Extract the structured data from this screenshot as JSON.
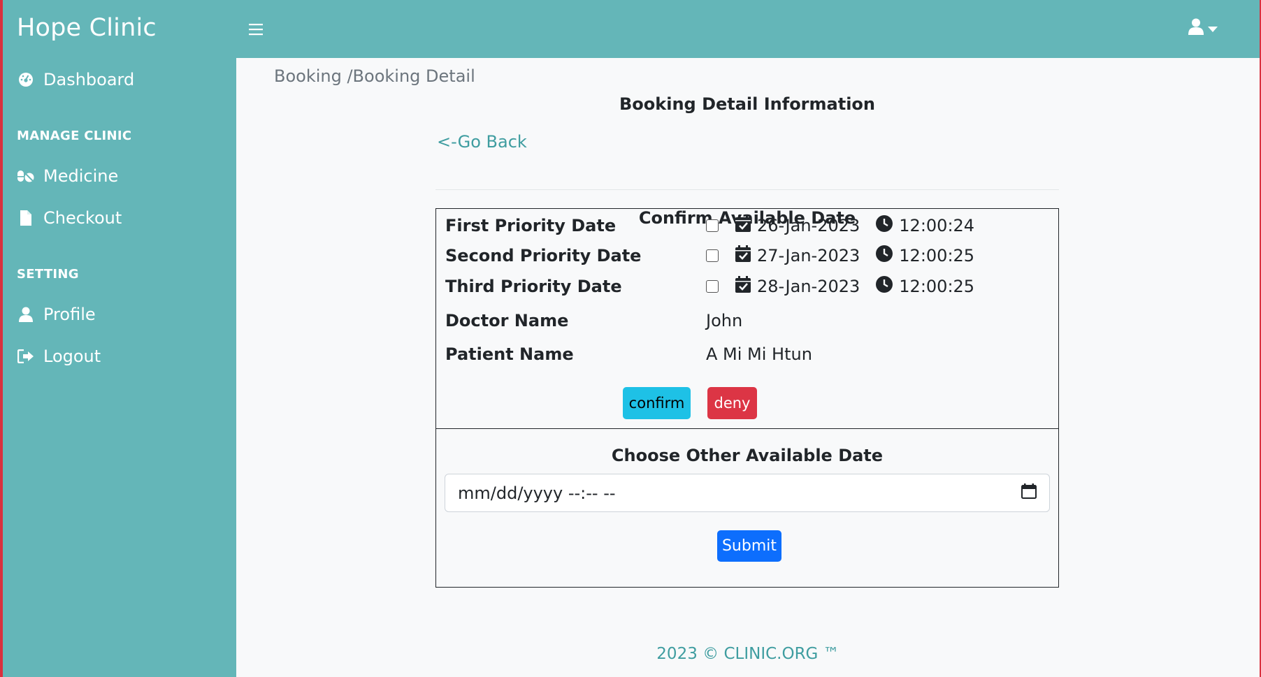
{
  "sidebar": {
    "brand": "Hope Clinic",
    "items": [
      {
        "label": "Dashboard",
        "icon": "dashboard-gauge-icon"
      },
      {
        "label": "Medicine",
        "icon": "pills-icon"
      },
      {
        "label": "Checkout",
        "icon": "file-icon"
      },
      {
        "label": "Profile",
        "icon": "user-icon"
      },
      {
        "label": "Logout",
        "icon": "logout-icon"
      }
    ],
    "headings": [
      "MANAGE CLINIC",
      "SETTING"
    ]
  },
  "topbar": {
    "menu_icon": "hamburger-icon",
    "user_icon": "user-icon",
    "caret_icon": "caret-down-icon"
  },
  "main": {
    "breadcrumb": "Booking /Booking Detail",
    "title": "Booking Detail Information",
    "go_back": "<-Go Back",
    "confirm_title": "Confirm Available Date",
    "priority_dates": [
      {
        "label": "First Priority Date",
        "date": "26-Jan-2023",
        "time": "12:00:24",
        "checked": false
      },
      {
        "label": "Second Priority Date",
        "date": "27-Jan-2023",
        "time": "12:00:25",
        "checked": false
      },
      {
        "label": "Third Priority Date",
        "date": "28-Jan-2023",
        "time": "12:00:25",
        "checked": false
      }
    ],
    "doctor": {
      "label": "Doctor Name",
      "value": "John"
    },
    "patient": {
      "label": "Patient Name",
      "value": "A Mi Mi Htun"
    },
    "confirm_label": "confirm",
    "deny_label": "deny",
    "other_title": "Choose Other Available Date",
    "datetime_placeholder": "mm/dd/yyyy --:-- --",
    "submit_label": "Submit"
  },
  "footer": {
    "text": "2023 © CLINIC.ORG ™"
  },
  "colors": {
    "sidebar_bg": "#64b6b8",
    "accent_teal": "#3f9da0",
    "confirm": "#1ec1e6",
    "deny": "#dc3545",
    "submit": "#0d6efd"
  }
}
